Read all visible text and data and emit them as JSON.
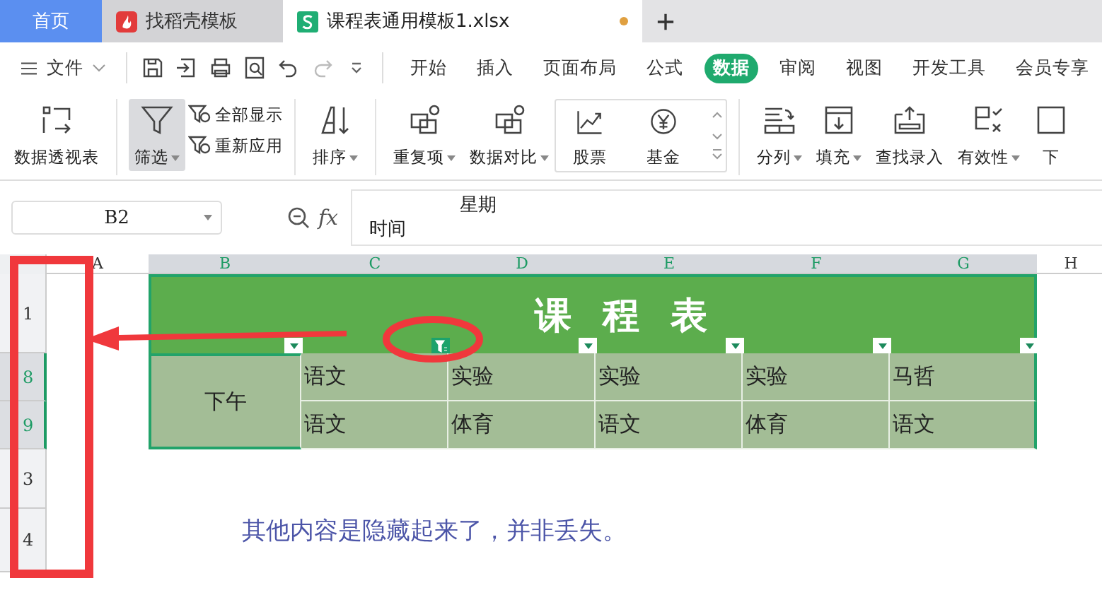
{
  "tabs": [
    {
      "label": "首页",
      "kind": "home",
      "selected": false
    },
    {
      "label": "找稻壳模板",
      "kind": "docer",
      "selected": false
    },
    {
      "label": "课程表通用模板1.xlsx",
      "kind": "sheet",
      "selected": true,
      "unsaved": true
    }
  ],
  "menu": {
    "file": "文件",
    "tabs": [
      {
        "label": "开始",
        "selected": false
      },
      {
        "label": "插入",
        "selected": false
      },
      {
        "label": "页面布局",
        "selected": false
      },
      {
        "label": "公式",
        "selected": false
      },
      {
        "label": "数据",
        "selected": true
      },
      {
        "label": "审阅",
        "selected": false
      },
      {
        "label": "视图",
        "selected": false
      },
      {
        "label": "开发工具",
        "selected": false
      },
      {
        "label": "会员专享",
        "selected": false
      }
    ]
  },
  "ribbon": [
    {
      "kind": "large",
      "label": "数据透视表",
      "dropdown": false,
      "pressed": false
    },
    {
      "kind": "large",
      "label": "筛选",
      "dropdown": true,
      "pressed": true
    },
    {
      "kind": "small",
      "label": "全部显示"
    },
    {
      "kind": "small",
      "label": "重新应用"
    },
    {
      "kind": "large",
      "label": "排序",
      "dropdown": true,
      "pressed": false
    },
    {
      "kind": "large",
      "label": "重复项",
      "dropdown": true,
      "pressed": false
    },
    {
      "kind": "large",
      "label": "数据对比",
      "dropdown": true,
      "pressed": false
    },
    {
      "kind": "boxed",
      "label": "股票"
    },
    {
      "kind": "boxed",
      "label": "基金"
    },
    {
      "kind": "large",
      "label": "分列",
      "dropdown": true,
      "pressed": false
    },
    {
      "kind": "large",
      "label": "填充",
      "dropdown": true,
      "pressed": false
    },
    {
      "kind": "large",
      "label": "查找录入",
      "dropdown": false,
      "pressed": false
    },
    {
      "kind": "large",
      "label": "有效性",
      "dropdown": true,
      "pressed": false
    },
    {
      "kind": "large",
      "label": "下",
      "dropdown": false,
      "pressed": false
    }
  ],
  "formula_bar": {
    "name_box": "B2",
    "fx": "fx",
    "lines": [
      "星期",
      "时间"
    ]
  },
  "sheet": {
    "columns": [
      {
        "label": "A",
        "selected": false
      },
      {
        "label": "B",
        "selected": true
      },
      {
        "label": "C",
        "selected": true
      },
      {
        "label": "D",
        "selected": true
      },
      {
        "label": "E",
        "selected": true
      },
      {
        "label": "F",
        "selected": true
      },
      {
        "label": "G",
        "selected": true
      },
      {
        "label": "H",
        "selected": false
      }
    ],
    "rows": [
      {
        "label": "1",
        "selected": false
      },
      {
        "label": "8",
        "selected": true
      },
      {
        "label": "9",
        "selected": true
      },
      {
        "label": "3",
        "selected": false
      },
      {
        "label": "4",
        "selected": false
      }
    ],
    "title": "课程表",
    "filters": [
      {
        "filtered": false
      },
      {
        "filtered": true
      },
      {
        "filtered": false
      },
      {
        "filtered": false
      },
      {
        "filtered": false
      },
      {
        "filtered": false
      }
    ],
    "period": "下午",
    "body": [
      [
        "语文",
        "实验",
        "实验",
        "实验",
        "马哲"
      ],
      [
        "语文",
        "体育",
        "语文",
        "体育",
        "语文"
      ]
    ],
    "note": "其他内容是隐藏起来了，并非丢失。"
  }
}
